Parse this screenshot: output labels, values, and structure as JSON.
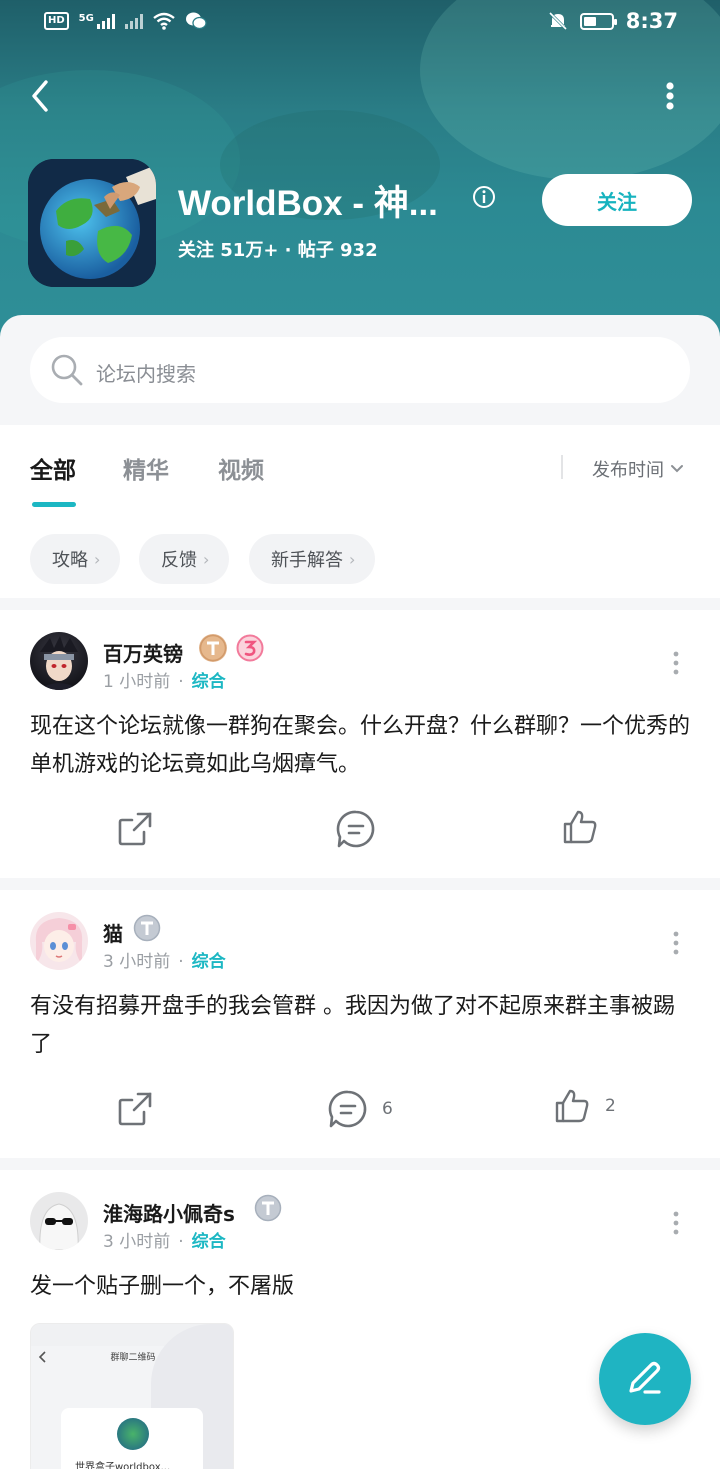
{
  "status_bar": {
    "left_chips": [
      "HD"
    ],
    "network_label": "5G",
    "time": "8:37"
  },
  "header": {
    "title": "WorldBox - 神...",
    "stats": "关注 51万+ · 帖子 932",
    "follow_label": "关注"
  },
  "search": {
    "placeholder": "论坛内搜索"
  },
  "tabs": {
    "items": [
      "全部",
      "精华",
      "视频"
    ],
    "active_index": 0,
    "sort_label": "发布时间"
  },
  "chips": [
    "攻略",
    "反馈",
    "新手解答"
  ],
  "posts": [
    {
      "username": "百万英镑",
      "time": "1 小时前",
      "category": "综合",
      "content": "现在这个论坛就像一群狗在聚会。什么开盘？什么群聊？一个优秀的单机游戏的论坛竟如此乌烟瘴气。",
      "comment_count": "",
      "like_count": ""
    },
    {
      "username": "猫",
      "time": "3 小时前",
      "category": "综合",
      "content": "有没有招募开盘手的我会管群  。我因为做了对不起原来群主事被踢了",
      "comment_count": "6",
      "like_count": "2"
    },
    {
      "username": "淮海路小佩奇s",
      "time": "3 小时前",
      "category": "综合",
      "content": "发一个贴子删一个，不屠版"
    }
  ],
  "thumbnail": {
    "title": "群聊二维码",
    "caption": "世界盒子worldbox..."
  },
  "colors": {
    "accent": "#1cb7c3",
    "header_bg": "#2a7d86",
    "fab": "#1fb4c2"
  },
  "icons": [
    "back-icon",
    "more-icon",
    "info-icon",
    "search-icon",
    "chevron-down-icon",
    "share-icon",
    "comment-icon",
    "like-icon",
    "edit-icon"
  ]
}
